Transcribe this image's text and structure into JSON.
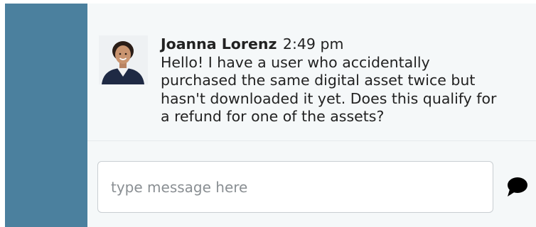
{
  "chat": {
    "message": {
      "author": "Joanna Lorenz",
      "time": "2:49 pm",
      "text": "Hello! I have a user who accidentally\npurchased the same digital asset twice but\nhasn't downloaded it yet. Does this qualify for\na refund for one of the assets?"
    },
    "composer": {
      "placeholder": "type message here"
    }
  },
  "colors": {
    "sidebar": "#4b809e",
    "panel": "#f5f8f9"
  },
  "icons": {
    "send": "speech-bubble-icon"
  }
}
